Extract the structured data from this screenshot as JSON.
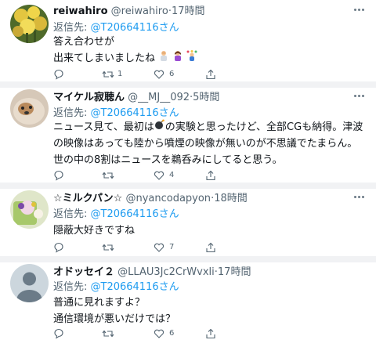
{
  "colors": {
    "accent": "#1d9bf0",
    "muted": "#536471",
    "text": "#0f1419",
    "divider": "#f1f2f4"
  },
  "replies": [
    {
      "name": "reiwahiro",
      "handle": "@reiwahiro",
      "time": "·17時間",
      "reply_prefix": "返信先: ",
      "mention": "@T20664116さん",
      "lines": [
        "答え合わせが",
        "出来てしまいましたね"
      ],
      "retweets": "1",
      "likes": "6",
      "comments": ""
    },
    {
      "name": "マイケル寂聴ん",
      "handle": "@__MJ__092",
      "time": "·5時間",
      "reply_prefix": "返信先: ",
      "mention": "@T20664116さん",
      "lines": [
        "ニュース見て、最初は",
        "の実験と思ったけど、全部CGも納得。津波",
        "の映像はあっても陸から噴煙の映像が無いのが不思議でたまらん。",
        "世の中の8割はニュースを鵜呑みにしてると思う。"
      ],
      "retweets": "",
      "likes": "4",
      "comments": ""
    },
    {
      "name": "☆ミルクパン☆",
      "handle": "@nyancodapyon",
      "time": "·18時間",
      "reply_prefix": "返信先: ",
      "mention": "@T20664116さん",
      "lines": [
        "隠蔽大好きですね"
      ],
      "retweets": "",
      "likes": "7",
      "comments": ""
    },
    {
      "name": "オドッセイ２",
      "handle": "@LLAU3Jc2CrWvxli",
      "time": "·17時間",
      "reply_prefix": "返信先: ",
      "mention": "@T20664116さん",
      "lines": [
        "普通に見れますよ？",
        "通信環境が悪いだけでは？"
      ],
      "retweets": "",
      "likes": "6",
      "comments": ""
    }
  ],
  "icons": [
    "more-icon",
    "comment-icon",
    "retweet-icon",
    "like-icon",
    "share-icon",
    "bomb-emoji",
    "man-facepalming-emoji",
    "woman-shrugging-emoji",
    "person-juggling-emoji"
  ]
}
